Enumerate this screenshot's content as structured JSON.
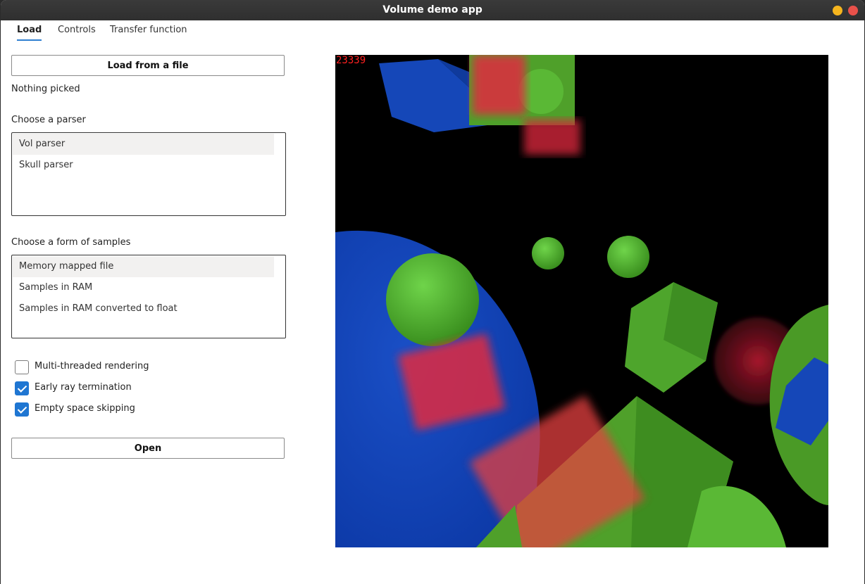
{
  "window": {
    "title": "Volume demo app"
  },
  "tabs": [
    {
      "label": "Load",
      "active": true
    },
    {
      "label": "Controls",
      "active": false
    },
    {
      "label": "Transfer function",
      "active": false
    }
  ],
  "load": {
    "load_button": "Load from a file",
    "picked_status": "Nothing picked",
    "parser_heading": "Choose a parser",
    "parsers": [
      "Vol parser",
      "Skull parser"
    ],
    "samples_heading": "Choose a form of samples",
    "sample_forms": [
      "Memory mapped file",
      "Samples in RAM",
      "Samples in RAM converted to float"
    ],
    "options": [
      {
        "label": "Multi-threaded rendering",
        "checked": false
      },
      {
        "label": "Early ray termination",
        "checked": true
      },
      {
        "label": "Empty space skipping",
        "checked": true
      }
    ],
    "open_button": "Open"
  },
  "render": {
    "frame_counter": "23339"
  },
  "colors": {
    "accent": "#1f76d2",
    "tab_underline": "#2f7fd1",
    "counter": "#ff2020"
  }
}
